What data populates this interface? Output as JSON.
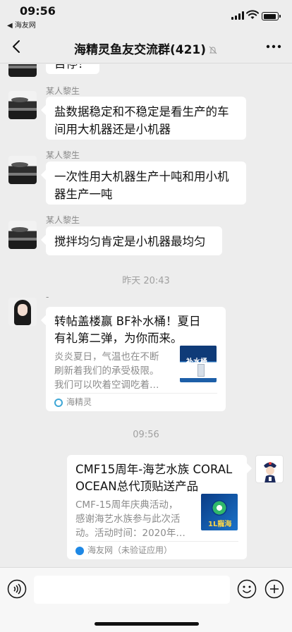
{
  "status_bar": {
    "time": "09:56",
    "back_app": "◀ 海友网"
  },
  "nav": {
    "title": "海精灵鱼友交流群(421)",
    "icons": [
      "back-icon",
      "mute-bell-icon",
      "more-icon"
    ]
  },
  "messages": [
    {
      "type": "text",
      "fragment": "目停！"
    },
    {
      "type": "text",
      "sender": "某人黎生",
      "lines": [
        "盐数据稳定和不稳定是看生产的车",
        "间用大机器还是小机器"
      ]
    },
    {
      "type": "text",
      "sender": "某人黎生",
      "lines": [
        "一次性用大机器生产十吨和用小机",
        "器生产一吨"
      ]
    },
    {
      "type": "text",
      "sender": "某人黎生",
      "lines": [
        "搅拌均匀肯定是小机器最均匀"
      ]
    }
  ],
  "timestamps": [
    "昨天 20:43",
    "09:56"
  ],
  "card1": {
    "sender": "-",
    "title_lines": [
      "转帖盖楼赢 BF补水桶！夏日",
      "有礼第二弹，为你而来。"
    ],
    "desc_lines": [
      "炎炎夏日，气温也在不断",
      "刷新着我们的承受极限。",
      "我们可以吹着空调吃着…"
    ],
    "thumb_label": "补水桶",
    "source": "海精灵"
  },
  "card2": {
    "title_lines": [
      "CMF15周年-海艺水族 CORAL",
      "OCEAN总代顶贴送产品"
    ],
    "desc_lines": [
      "CMF-15周年庆典活动，",
      "感谢海艺水族参与此次活",
      "动。活动时间：2020年…"
    ],
    "thumb_label": "1L寵海",
    "source": "海友网（未验证应用）"
  },
  "colors": {
    "background": "#ededed",
    "bubble": "#ffffff",
    "secondary_text": "#8c8c8c",
    "timestamp": "#a0a0a0"
  }
}
